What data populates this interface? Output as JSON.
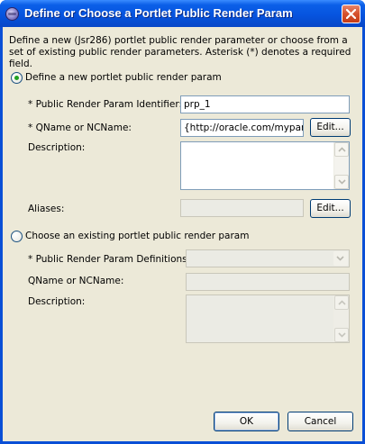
{
  "window": {
    "title": "Define or Choose a Portlet Public Render Param"
  },
  "intro_text": "Define a new (Jsr286) portlet public render parameter or choose from a set of existing public render parameters. Asterisk (*) denotes a required field.",
  "define_section": {
    "radio_label": "Define a new portlet public render param",
    "selected": true,
    "identifier_label": "* Public Render Param Identifier:",
    "identifier_value": "prp_1",
    "qname_label": "* QName or NCName:",
    "qname_value": "{http://oracle.com/mypar...",
    "edit_label": "Edit...",
    "description_label": "Description:",
    "description_value": "",
    "aliases_label": "Aliases:",
    "aliases_value": "",
    "aliases_edit_label": "Edit..."
  },
  "choose_section": {
    "radio_label": "Choose an existing portlet public render param",
    "selected": false,
    "definitions_label": "* Public Render Param Definitions:",
    "definitions_value": "",
    "qname_label": "QName or NCName:",
    "qname_value": "",
    "description_label": "Description:",
    "description_value": ""
  },
  "footer": {
    "ok_label": "OK",
    "cancel_label": "Cancel"
  },
  "icons": {
    "app": "eclipse-icon",
    "close": "close-icon",
    "scroll_up": "scroll-up-icon",
    "scroll_down": "scroll-down-icon",
    "dropdown": "chevron-down-icon"
  },
  "colors": {
    "titlebar": "#0654df",
    "dialog_bg": "#ece9d8",
    "radio_dot": "#21a121",
    "field_border": "#7f9db9"
  }
}
